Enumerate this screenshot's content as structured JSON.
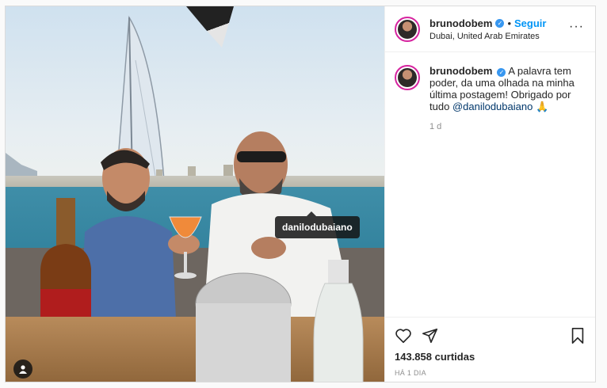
{
  "photo": {
    "tag_label": "danilodubaiano",
    "tag_icon": "user-icon"
  },
  "header": {
    "username": "brunodobem",
    "follow_label": "Seguir",
    "separator": "•",
    "location": "Dubai, United Arab Emirates",
    "more_icon": "more-options-icon"
  },
  "caption": {
    "username": "brunodobem",
    "text": "A palavra tem poder, da uma olhada na minha última postagem! Obrigado por tudo",
    "mention": "@danilodubaiano",
    "emoji": "🙏",
    "age": "1 d"
  },
  "actions": {
    "likes": "143.858 curtidas",
    "posted": "HÁ 1 DIA"
  },
  "colors": {
    "link_blue": "#0095f6",
    "verified_blue": "#3897f0",
    "mention_blue": "#00376b"
  }
}
